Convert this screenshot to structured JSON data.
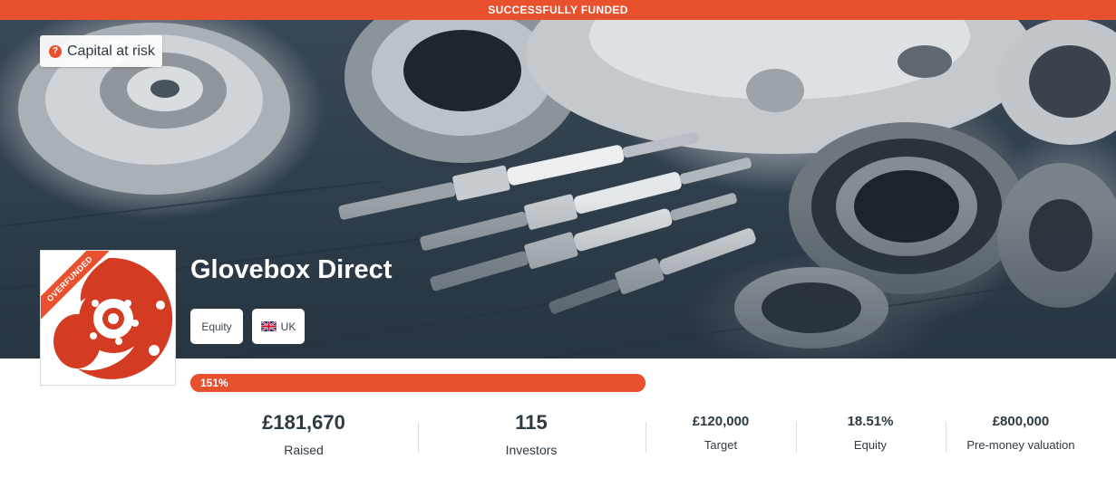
{
  "banner": {
    "status": "SUCCESSFULLY FUNDED"
  },
  "risk": {
    "icon": "question-mark-icon",
    "icon_glyph": "?",
    "label": "Capital at risk"
  },
  "company": {
    "name": "Glovebox Direct",
    "logo_icon": "brake-disc-logo",
    "ribbon": "OVERFUNDED"
  },
  "tags": {
    "equity": "Equity",
    "country": "UK",
    "country_flag": "uk-flag-icon"
  },
  "progress": {
    "label": "151%",
    "percent": 151
  },
  "stats": {
    "raised": {
      "value": "£181,670",
      "label": "Raised"
    },
    "investors": {
      "value": "115",
      "label": "Investors"
    },
    "target": {
      "value": "£120,000",
      "label": "Target"
    },
    "equity": {
      "value": "18.51%",
      "label": "Equity"
    },
    "valuation": {
      "value": "£800,000",
      "label": "Pre-money valuation"
    }
  },
  "colors": {
    "accent": "#e8502e",
    "text": "#2c3a44"
  }
}
